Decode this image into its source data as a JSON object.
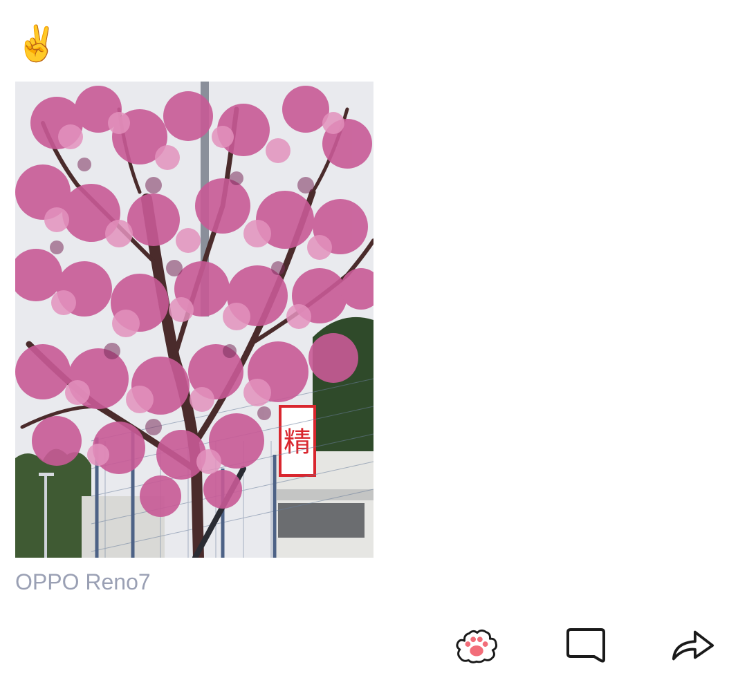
{
  "post": {
    "text": "✌️",
    "device": "OPPO Reno7"
  },
  "photo": {
    "subject": "cherry-blossom-tree",
    "sign_text": "精"
  },
  "actions": [
    {
      "icon": "paw-like-icon"
    },
    {
      "icon": "comment-icon"
    },
    {
      "icon": "share-icon"
    }
  ],
  "colors": {
    "device_label": "#9aa0b4",
    "icon_stroke": "#1a1a1a",
    "paw_pad": "#f26d79",
    "blossom": "#c85a96",
    "sign_red": "#d9262e"
  }
}
